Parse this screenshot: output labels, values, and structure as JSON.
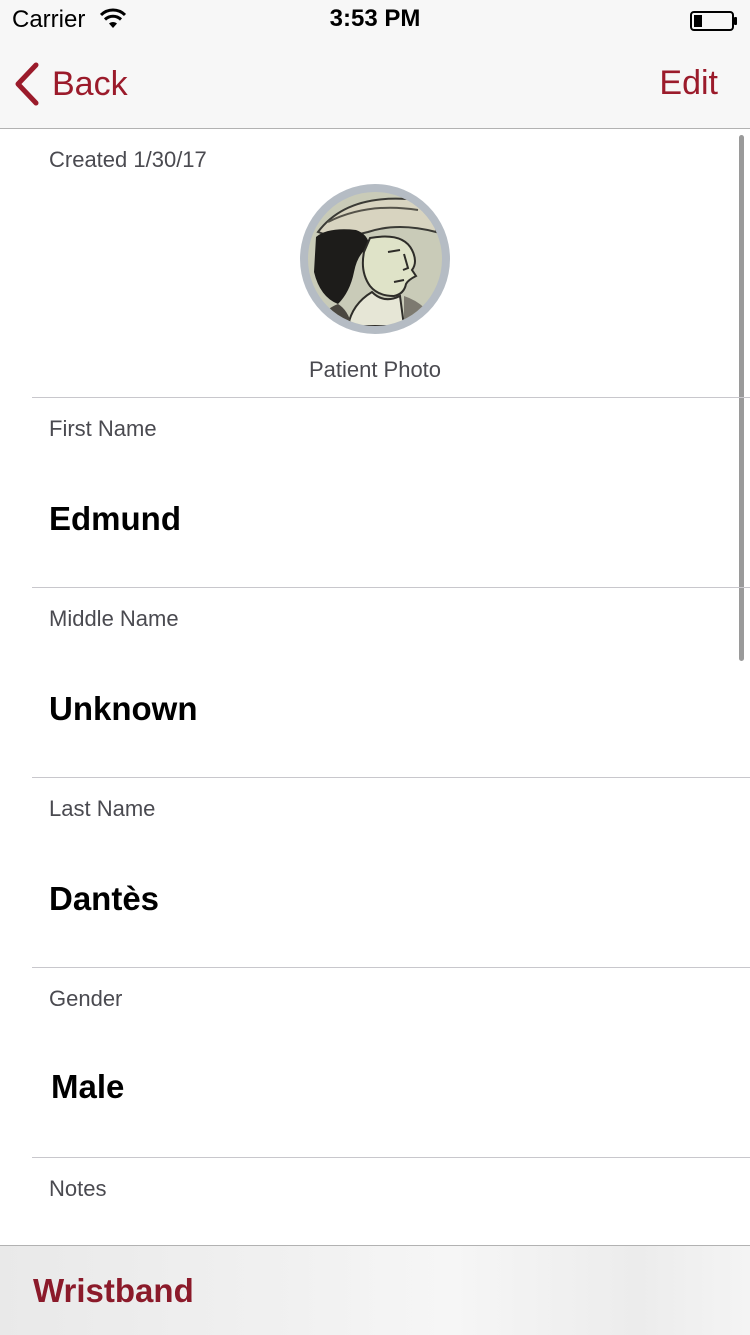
{
  "status_bar": {
    "carrier": "Carrier",
    "time": "3:53 PM"
  },
  "nav": {
    "back_label": "Back",
    "edit_label": "Edit"
  },
  "patient": {
    "created": "Created 1/30/17",
    "photo_label": "Patient Photo",
    "fields": [
      {
        "label": "First Name",
        "value": "Edmund"
      },
      {
        "label": "Middle Name",
        "value": "Unknown"
      },
      {
        "label": "Last Name",
        "value": "Dantès"
      },
      {
        "label": "Gender",
        "value": "Male"
      },
      {
        "label": "Notes",
        "value": ""
      }
    ]
  },
  "toolbar": {
    "wristband_label": "Wristband"
  },
  "colors": {
    "accent": "#9b1b2b",
    "label": "#4a4a50",
    "separator": "#c8c7cc",
    "bar_background": "#f7f7f7"
  },
  "icons": [
    "wifi-icon",
    "battery-icon",
    "chevron-left-icon"
  ]
}
